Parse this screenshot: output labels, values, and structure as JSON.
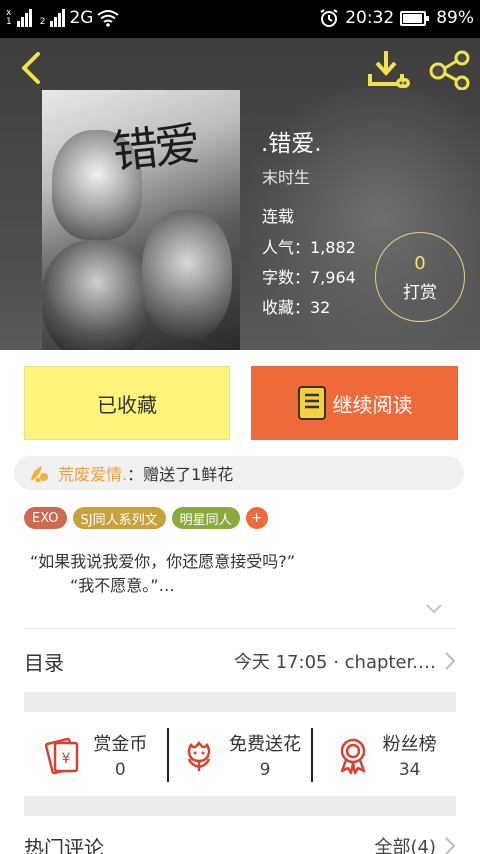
{
  "status_bar": {
    "network": "2G",
    "time": "20:32",
    "battery": "89%"
  },
  "book": {
    "cover_title": "错爱",
    "title": ".错爱.",
    "author": "末时生",
    "state": "连载",
    "popularity": "人气：1,882",
    "word_count": "字数：7,964",
    "favorites": "收藏：32"
  },
  "reward": {
    "count": "0",
    "label": "打赏"
  },
  "actions": {
    "collected_label": "已收藏",
    "read_label": "继续阅读"
  },
  "gift": {
    "user": "荒废爱情.",
    "text": "：赠送了1鲜花"
  },
  "tags": [
    "EXO",
    "SJ同人系列文",
    "明星同人"
  ],
  "tag_add": "+",
  "intro": {
    "line1": "“如果我说我爱你，你还愿意接受吗?”",
    "line2": "“我不愿意。”…"
  },
  "toc": {
    "label": "目录",
    "update": "今天 17:05 · chapter.…"
  },
  "stats": [
    {
      "label": "赏金币",
      "value": "0",
      "icon": "red-envelope-icon"
    },
    {
      "label": "免费送花",
      "value": "9",
      "icon": "flower-icon"
    },
    {
      "label": "粉丝榜",
      "value": "34",
      "icon": "medal-icon"
    }
  ],
  "comments": {
    "label": "热门评论",
    "all": "全部(4)"
  },
  "colors": {
    "accent_orange": "#ee6a3a",
    "collect_yellow": "#fdf47c",
    "icon_yellow": "#f2e34a",
    "stat_red": "#d9412f"
  }
}
